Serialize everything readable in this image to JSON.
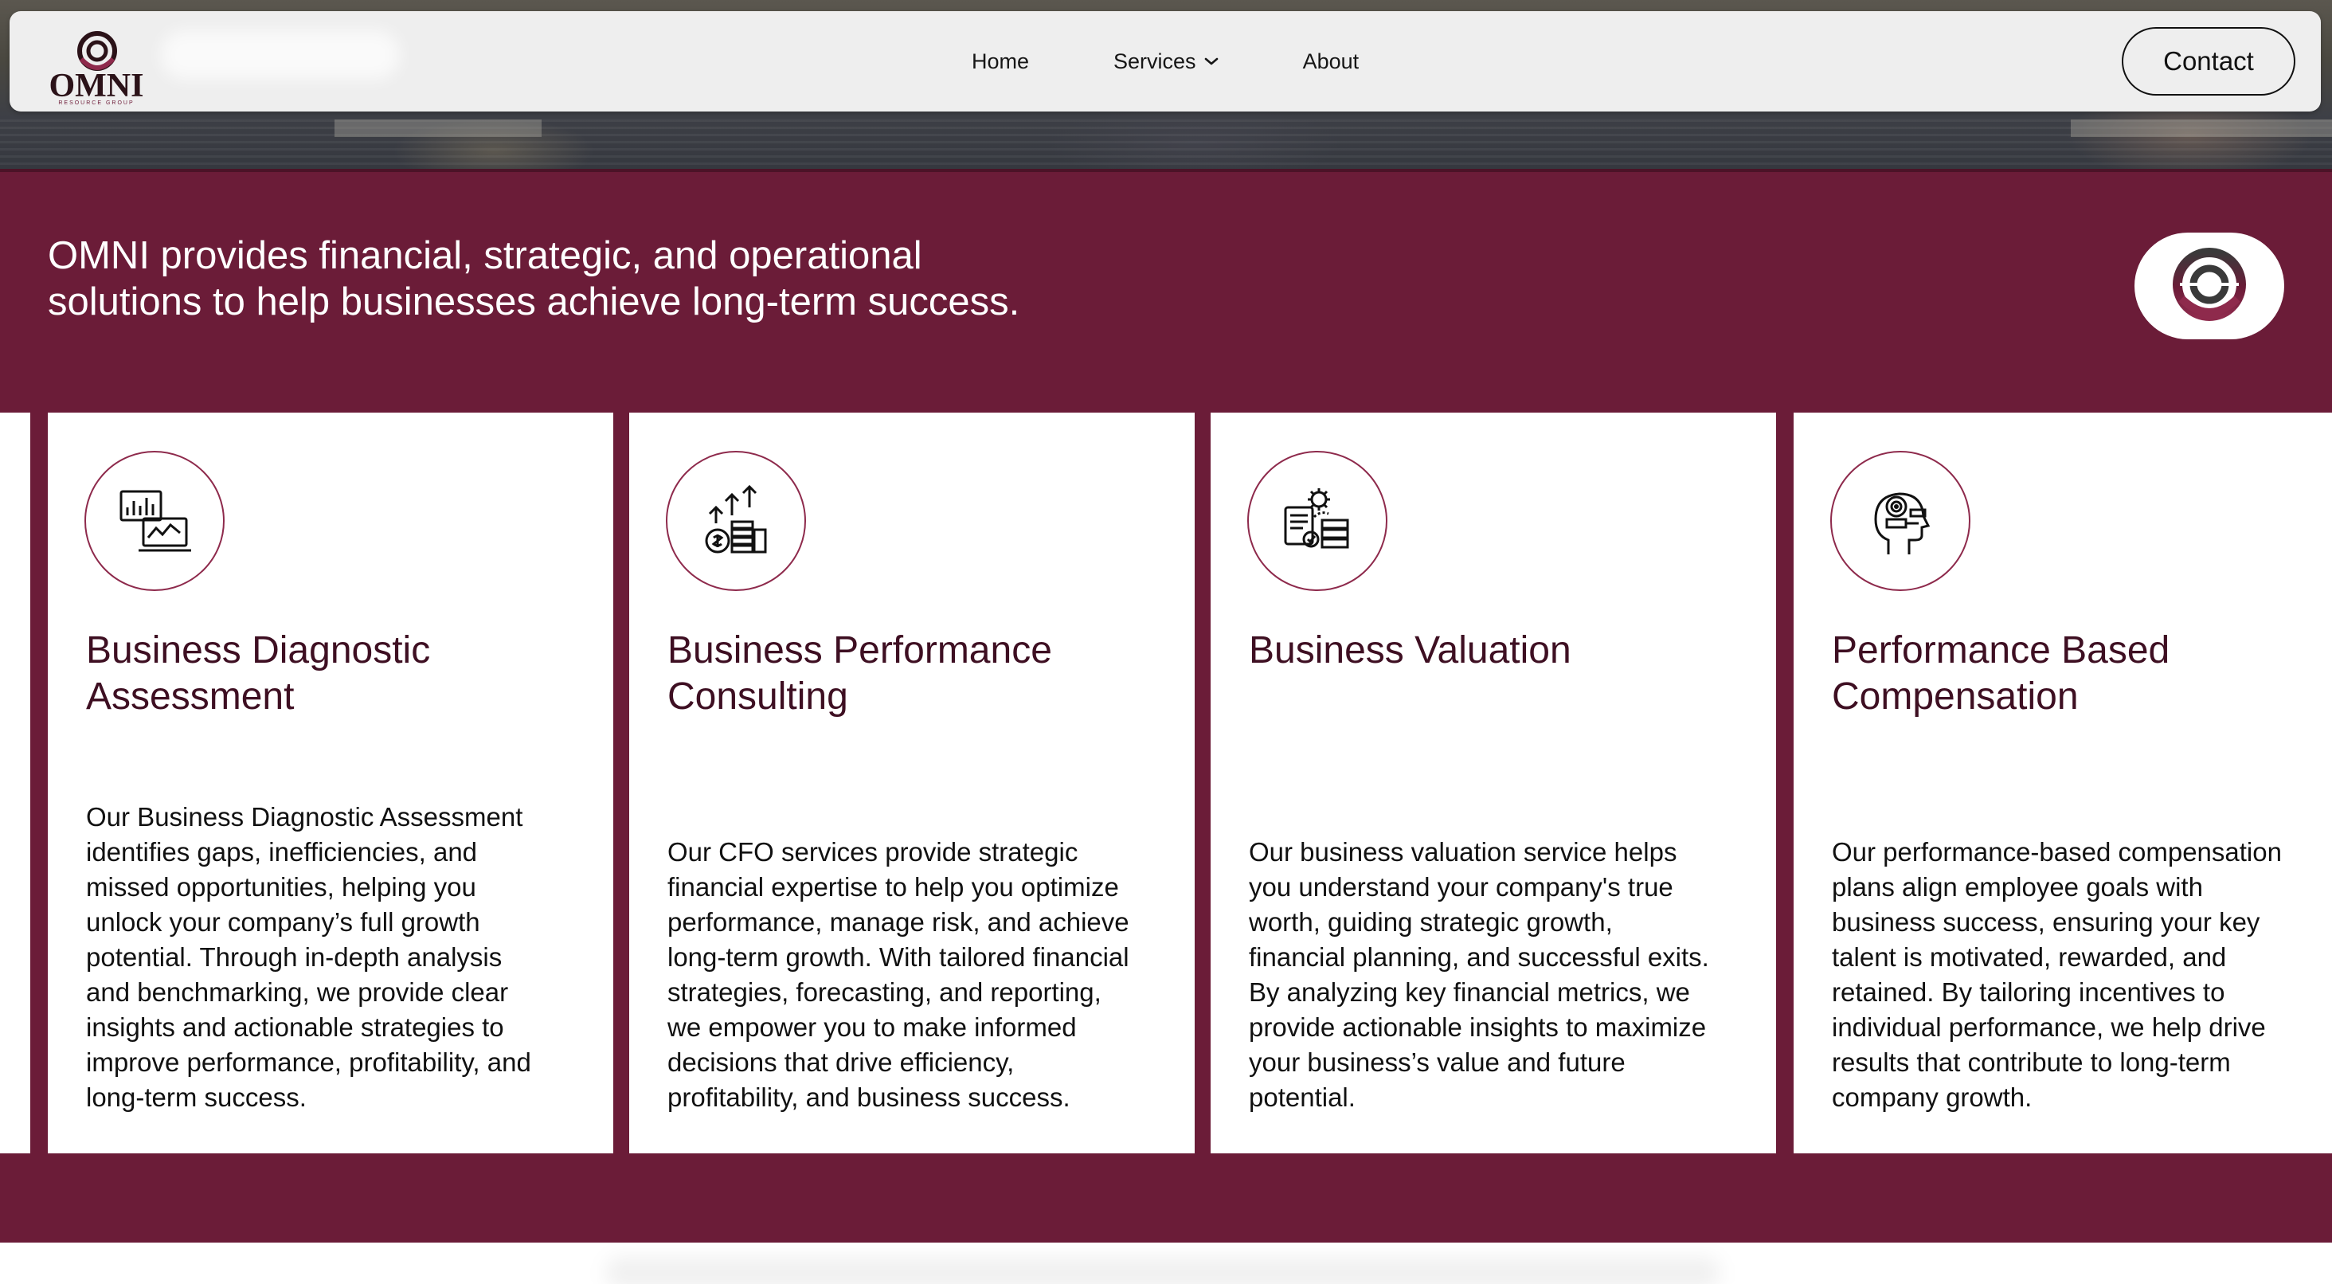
{
  "brand": {
    "name": "OMNI",
    "subtitle": "RESOURCE GROUP",
    "primary_color": "#6b1c38",
    "logo_icon": "omni-rings-icon"
  },
  "nav": {
    "items": [
      {
        "label": "Home"
      },
      {
        "label": "Services",
        "icon": "chevron-down-icon"
      },
      {
        "label": "About"
      }
    ],
    "contact_label": "Contact"
  },
  "hero": {
    "tagline_line1": "OMNI provides financial, strategic, and operational",
    "tagline_line2": "solutions to help businesses achieve long-term success."
  },
  "cards": [
    {
      "icon": "analytics-dashboard-icon",
      "title_line1": "Business Diagnostic",
      "title_line2": "Assessment",
      "body": [
        "Our Business Diagnostic Assessment",
        "identifies gaps, inefficiencies, and",
        "missed opportunities, helping you",
        "unlock your company’s full growth",
        "potential. Through in-depth analysis",
        "and benchmarking, we provide clear",
        "insights and actionable strategies to",
        "improve performance, profitability, and",
        "long-term success."
      ]
    },
    {
      "icon": "growth-coins-icon",
      "title_line1": "Business Performance",
      "title_line2": "Consulting",
      "body": [
        "Our CFO services provide strategic",
        "financial expertise to help you optimize",
        "performance, manage risk, and achieve",
        "long-term growth. With tailored financial",
        "strategies, forecasting, and reporting,",
        "we empower you to make informed",
        "decisions that drive efficiency,",
        "profitability, and business success."
      ]
    },
    {
      "icon": "valuation-report-icon",
      "title_line1": "Business Valuation",
      "title_line2": "",
      "body": [
        "Our business valuation service helps",
        "you understand your company's true",
        "worth, guiding strategic growth,",
        "financial planning, and successful exits.",
        "By analyzing key financial metrics, we",
        "provide actionable insights to maximize",
        "your business’s value and future",
        "potential."
      ]
    },
    {
      "icon": "head-target-icon",
      "title_line1": "Performance Based",
      "title_line2": "Compensation",
      "body": [
        "Our performance-based compensation",
        "plans align employee goals with",
        "business success, ensuring your key",
        "talent is motivated, rewarded, and",
        "retained. By tailoring incentives to",
        "individual performance, we help drive",
        "results that contribute to long-term",
        "company growth."
      ]
    }
  ]
}
